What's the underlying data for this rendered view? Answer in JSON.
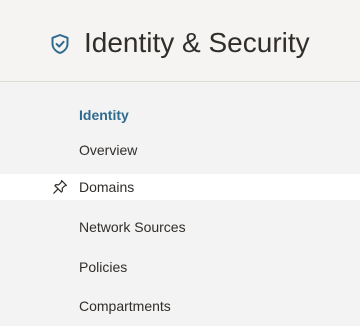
{
  "header": {
    "title": "Identity & Security",
    "icon": "shield-check-icon",
    "accent_color": "#2f6b8f"
  },
  "nav": {
    "section_heading": "Identity",
    "items": [
      {
        "label": "Overview"
      },
      {
        "label": "Domains",
        "pinned_icon": "pin-icon"
      },
      {
        "label": "Network Sources"
      },
      {
        "label": "Policies"
      },
      {
        "label": "Compartments"
      }
    ]
  }
}
